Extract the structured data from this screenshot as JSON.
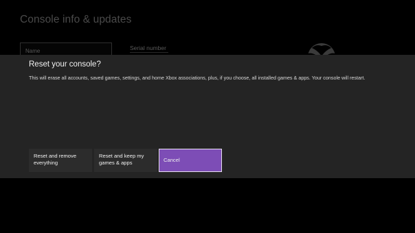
{
  "background_page": {
    "title": "Console info & updates",
    "name_field_label": "Name",
    "serial_number_label": "Serial number"
  },
  "dialog": {
    "title": "Reset your console?",
    "message": "This will erase all accounts, saved games, settings, and home Xbox associations, plus, if you choose, all installed games & apps. Your console will restart.",
    "buttons": {
      "reset_remove_line1": "Reset and remove",
      "reset_remove_line2": "everything",
      "reset_keep_line1": "Reset and keep my",
      "reset_keep_line2": "games & apps",
      "cancel": "Cancel"
    }
  },
  "colors": {
    "background": "#000000",
    "dialog_background": "#242424",
    "button_background": "#2c2c2c",
    "focused_button": "#7d4db6"
  },
  "icons": {
    "logo": "xbox-logo-icon"
  }
}
